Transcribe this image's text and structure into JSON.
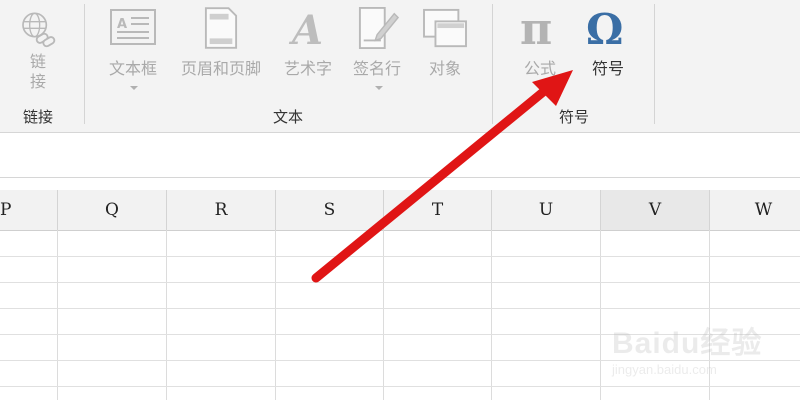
{
  "ribbon": {
    "groups": {
      "link": {
        "label": "链接",
        "button": "链\n接"
      },
      "text": {
        "label": "文本",
        "buttons": [
          "文本框",
          "页眉和页脚",
          "艺术字",
          "签名行",
          "对象"
        ]
      },
      "symbols": {
        "label": "符号",
        "buttons": [
          "公式",
          "符号"
        ]
      }
    }
  },
  "sheet": {
    "columns": [
      "P",
      "Q",
      "R",
      "S",
      "T",
      "U",
      "V",
      "W"
    ],
    "active_column": "V"
  },
  "annotation": {
    "type": "arrow",
    "color": "#e01515",
    "points_to": "符号"
  },
  "watermark": {
    "brand": "Baidu经验",
    "url": "jingyan.baidu.com"
  },
  "colors": {
    "ribbon_bg": "#f3f3f3",
    "omega_icon": "#3a6ea5",
    "disabled": "#a9a9a9"
  },
  "icons": [
    "link-icon",
    "textbox-icon",
    "header-footer-icon",
    "wordart-icon",
    "signature-icon",
    "object-icon",
    "pi-icon",
    "omega-icon"
  ]
}
